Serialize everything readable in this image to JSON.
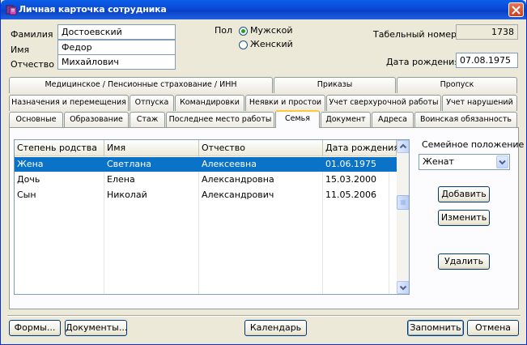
{
  "window": {
    "title": "Личная карточка сотрудника"
  },
  "form": {
    "surname_label": "Фамилия",
    "surname": "Достоевский",
    "name_label": "Имя",
    "name": "Федор",
    "patronymic_label": "Отчество",
    "patronymic": "Михайлович",
    "gender_label": "Пол",
    "gender_options": [
      "Мужской",
      "Женский"
    ],
    "gender_selected": "Мужской",
    "tab_number_label": "Табельный номер",
    "tab_number": "1738",
    "birth_label": "Дата рождения",
    "birth": "07.08.1975"
  },
  "tabs": {
    "row1": [
      "Медицинское / Пенсионные страхование / ИНН",
      "Приказы",
      "Пропуск"
    ],
    "row2": [
      "Назначения и перемещения",
      "Отпуска",
      "Командировки",
      "Неявки и простои",
      "Учет сверхурочной работы",
      "Учет нарушений"
    ],
    "row3": [
      "Основные",
      "Образование",
      "Стаж",
      "Последнее место работы",
      "Семья",
      "Документ",
      "Адреса",
      "Воинская обязанность"
    ],
    "active": "Семья"
  },
  "family_table": {
    "columns": [
      "Степень родства",
      "Имя",
      "Отчество",
      "Дата рождения"
    ],
    "rows": [
      [
        "Жена",
        "Светлана",
        "Алексеевна",
        "01.06.1975"
      ],
      [
        "Дочь",
        "Елена",
        "Александровна",
        "15.03.2000"
      ],
      [
        "Сын",
        "Николай",
        "Александрович",
        "11.05.2006"
      ]
    ],
    "selected_row": 0
  },
  "marital": {
    "label": "Семейное положение",
    "value": "Женат"
  },
  "side_buttons": {
    "add": "Добавить",
    "edit": "Изменить",
    "delete": "Удалить"
  },
  "bottom_buttons": {
    "forms": "Формы...",
    "documents": "Документы...",
    "calendar": "Календарь",
    "save": "Запомнить",
    "cancel": "Отмена"
  },
  "colors": {
    "title_bar": "#0a49d6",
    "selection": "#0a73c8",
    "active_tab_accent": "#ffc83c"
  }
}
